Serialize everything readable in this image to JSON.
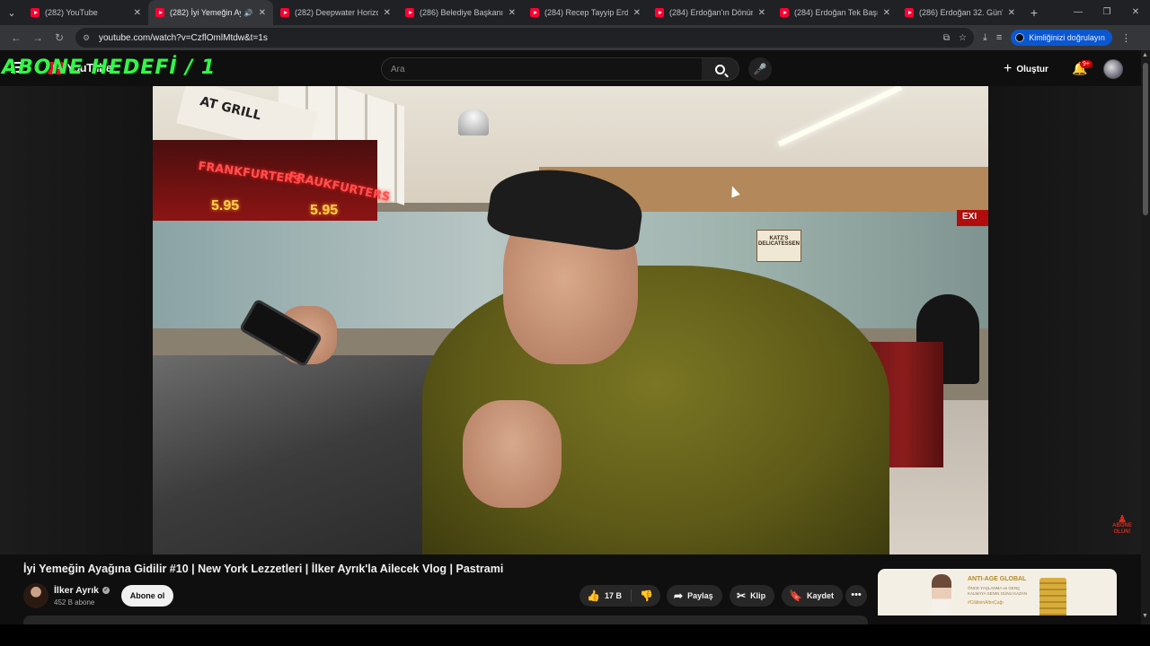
{
  "browser": {
    "tabs": [
      {
        "title": "(282) YouTube",
        "active": false
      },
      {
        "title": "(282) İyi Yemeğin Ay...",
        "active": true
      },
      {
        "title": "(282) Deepwater Horizon",
        "active": false
      },
      {
        "title": "(286) Belediye Başkanı Er...",
        "active": false
      },
      {
        "title": "(284) Recep Tayyip Erdoğ...",
        "active": false
      },
      {
        "title": "(284) Erdoğan'ın Dönüm...",
        "active": false
      },
      {
        "title": "(284) Erdoğan Tek Başına...",
        "active": false
      },
      {
        "title": "(286) Erdoğan 32. Gün'de...",
        "active": false
      }
    ],
    "url": "youtube.com/watch?v=CzflOmlMtdw&t=1s",
    "verify_label": "Kimliğinizi doğrulayın"
  },
  "youtube": {
    "logo_text": "YouTube",
    "search_placeholder": "Ara",
    "create_label": "Oluştur",
    "notification_badge": "9+"
  },
  "overlay": {
    "text": "ABONE HEDEFİ / 1"
  },
  "video_frame": {
    "grill_sign": "AT GRILL",
    "neon_1": "FRANKFURTERS",
    "neon_2": "FRAUKFURTERS",
    "price_1": "5.95",
    "price_2": "5.95",
    "shop_sign": "KATZ'S DELICATESSEN",
    "exit_sign": "EXI",
    "watermark": "ABONE OLUN!"
  },
  "video": {
    "title": "İyi Yemeğin Ayağına Gidilir #10 | New York Lezzetleri | İlker Ayrık'la Ailecek Vlog | Pastrami",
    "channel_name": "İlker Ayrık",
    "subscribers": "452 B abone",
    "subscribe_label": "Abone ol",
    "likes": "17 B",
    "share_label": "Paylaş",
    "clip_label": "Klip",
    "save_label": "Kaydet"
  },
  "ad": {
    "brand": "ANTI-AGE GLOBAL",
    "subtitle": "ÖNCE YAŞLANMA ve GENÇ KALMAYA SENIN GÜNU KAZAN",
    "tag": "#CildininAltınÇağı"
  },
  "colors": {
    "overlay_green": "#34f54a",
    "youtube_red": "#ff0033",
    "verify_blue": "#0b57d0"
  }
}
